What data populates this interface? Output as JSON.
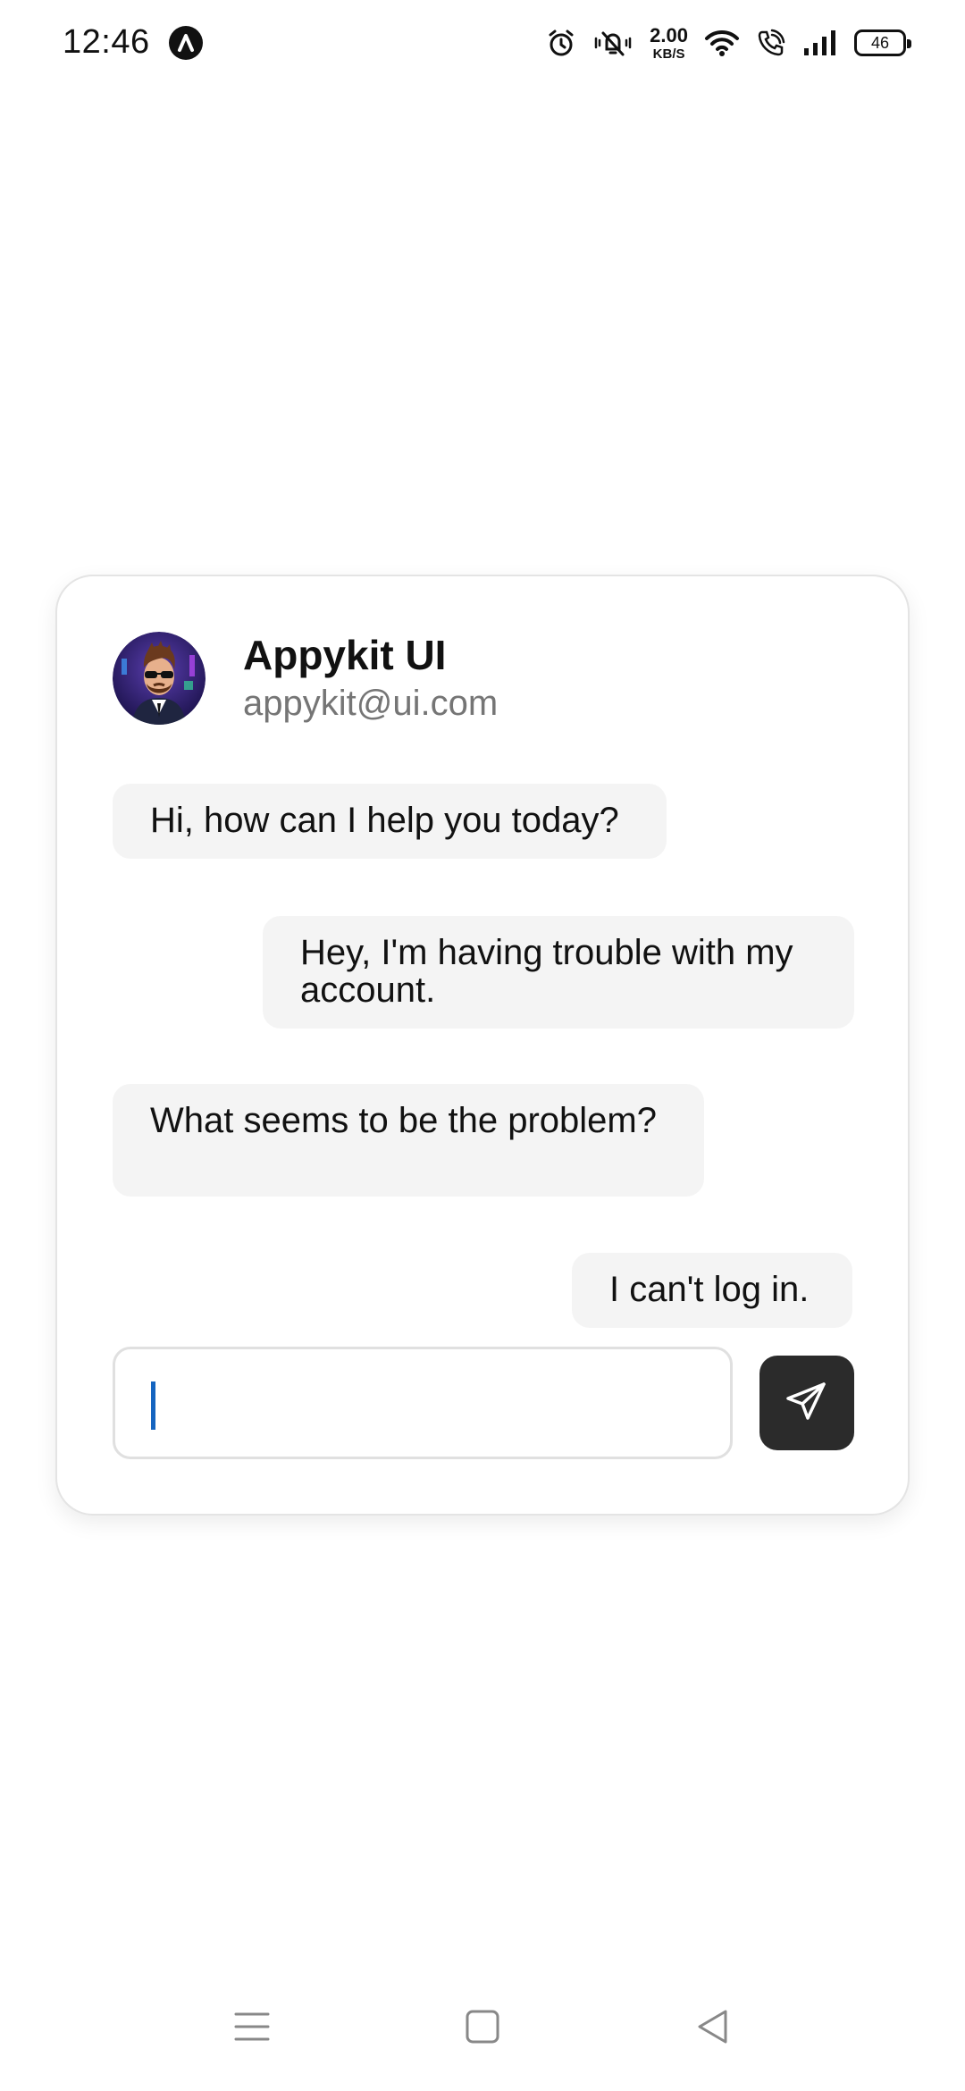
{
  "status_bar": {
    "time": "12:46",
    "net_speed_value": "2.00",
    "net_speed_unit": "KB/S",
    "battery_level": "46",
    "icons": [
      "app-badge-icon",
      "alarm-icon",
      "vibrate-icon",
      "wifi-icon",
      "wifi-call-icon",
      "signal-icon",
      "battery-icon"
    ]
  },
  "chat": {
    "title": "Appykit UI",
    "email": "appykit@ui.com",
    "messages": [
      {
        "from": "agent",
        "text": "Hi, how can I help you today?"
      },
      {
        "from": "user",
        "text": "Hey, I'm having trouble with my account."
      },
      {
        "from": "agent",
        "text": "What seems to be the problem?"
      },
      {
        "from": "user",
        "text": "I can't log in."
      }
    ],
    "input_value": "",
    "input_placeholder": "",
    "send_icon": "send-icon"
  },
  "nav_bar": {
    "icons": [
      "menu-icon",
      "home-icon",
      "back-icon"
    ]
  },
  "colors": {
    "bubble_bg": "#f4f4f4",
    "send_button_bg": "#2b2b2b",
    "caret": "#1565c0",
    "secondary_text": "#757575"
  }
}
